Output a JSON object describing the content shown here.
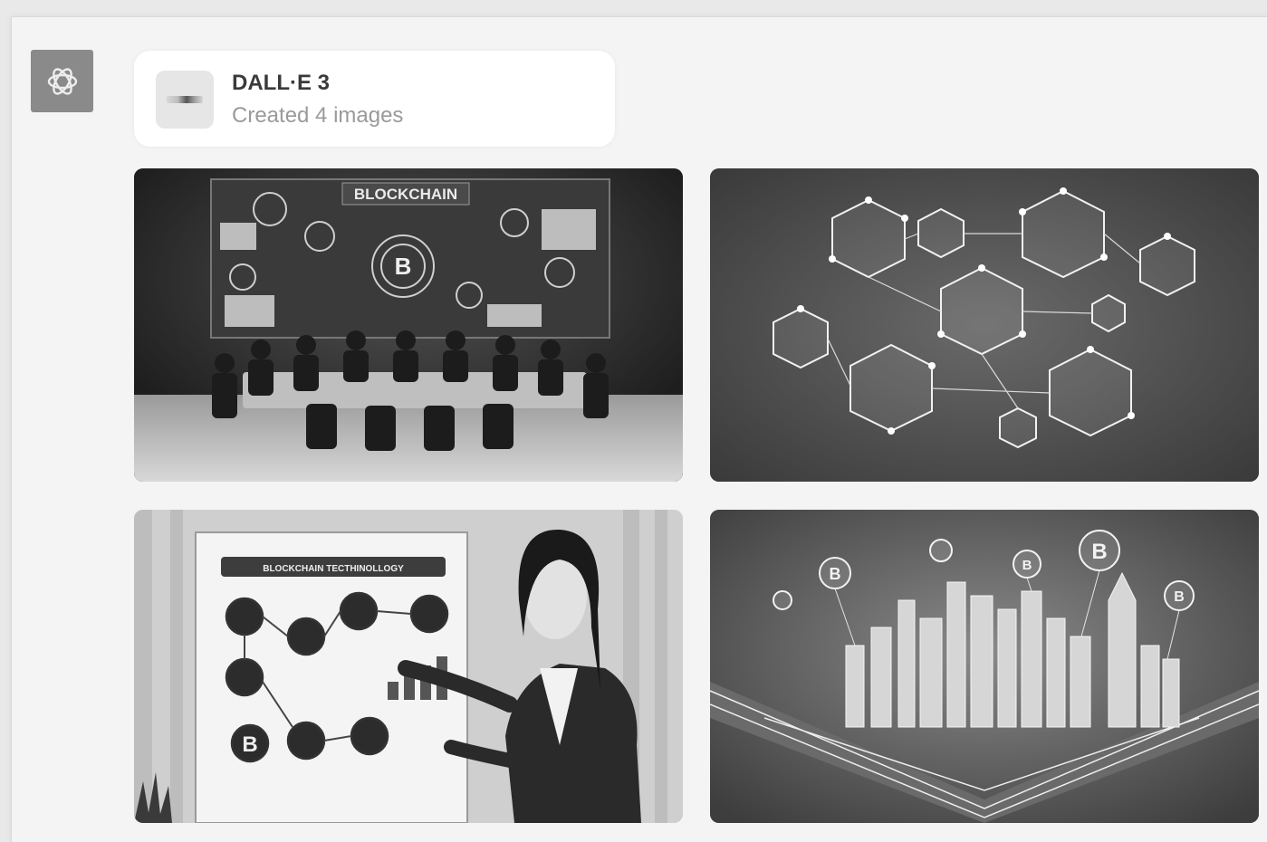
{
  "plugin": {
    "title": "DALL·E 3",
    "subtitle": "Created 4 images"
  },
  "images": [
    {
      "poster_text": "BLOCKCHAIN",
      "coin_letter": "B"
    },
    {},
    {
      "poster_text": "BLOCKCHAIN TECTHINOLLOGY",
      "coin_letter": "B"
    },
    {
      "coin_letter": "B"
    }
  ],
  "icons": {
    "avatar": "openai-logo-icon",
    "plugin_thumb": "dalle-thumbnail-icon"
  },
  "colors": {
    "background": "#f4f4f4",
    "card": "#ffffff",
    "avatar": "#8a8a8a"
  }
}
